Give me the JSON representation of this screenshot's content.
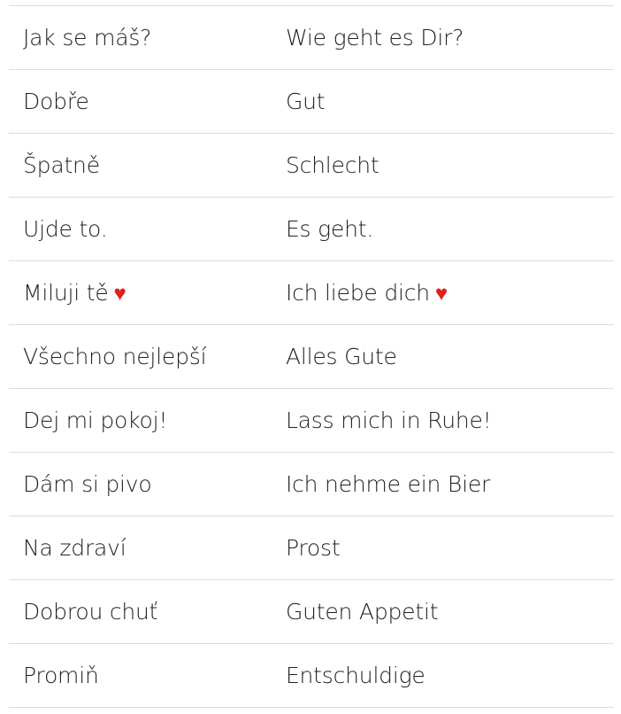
{
  "colors": {
    "heart": "#e0201b",
    "divider": "#dcdcdc",
    "text": "#222222"
  },
  "rows": [
    {
      "cs": "Jak se máš?",
      "de": "Wie geht es Dir?",
      "heart": false
    },
    {
      "cs": "Dobře",
      "de": "Gut",
      "heart": false
    },
    {
      "cs": "Špatně",
      "de": "Schlecht",
      "heart": false
    },
    {
      "cs": "Ujde to.",
      "de": "Es geht.",
      "heart": false
    },
    {
      "cs": "Miluji tě",
      "de": "Ich liebe dich",
      "heart": true,
      "heart_symbol": "♥"
    },
    {
      "cs": "Všechno nejlepší",
      "de": "Alles Gute",
      "heart": false
    },
    {
      "cs": "Dej mi pokoj!",
      "de": "Lass mich in Ruhe!",
      "heart": false
    },
    {
      "cs": "Dám si pivo",
      "de": "Ich nehme ein Bier",
      "heart": false
    },
    {
      "cs": "Na zdraví",
      "de": "Prost",
      "heart": false
    },
    {
      "cs": "Dobrou chuť",
      "de": "Guten Appetit",
      "heart": false
    },
    {
      "cs": "Promiň",
      "de": "Entschuldige",
      "heart": false
    }
  ]
}
